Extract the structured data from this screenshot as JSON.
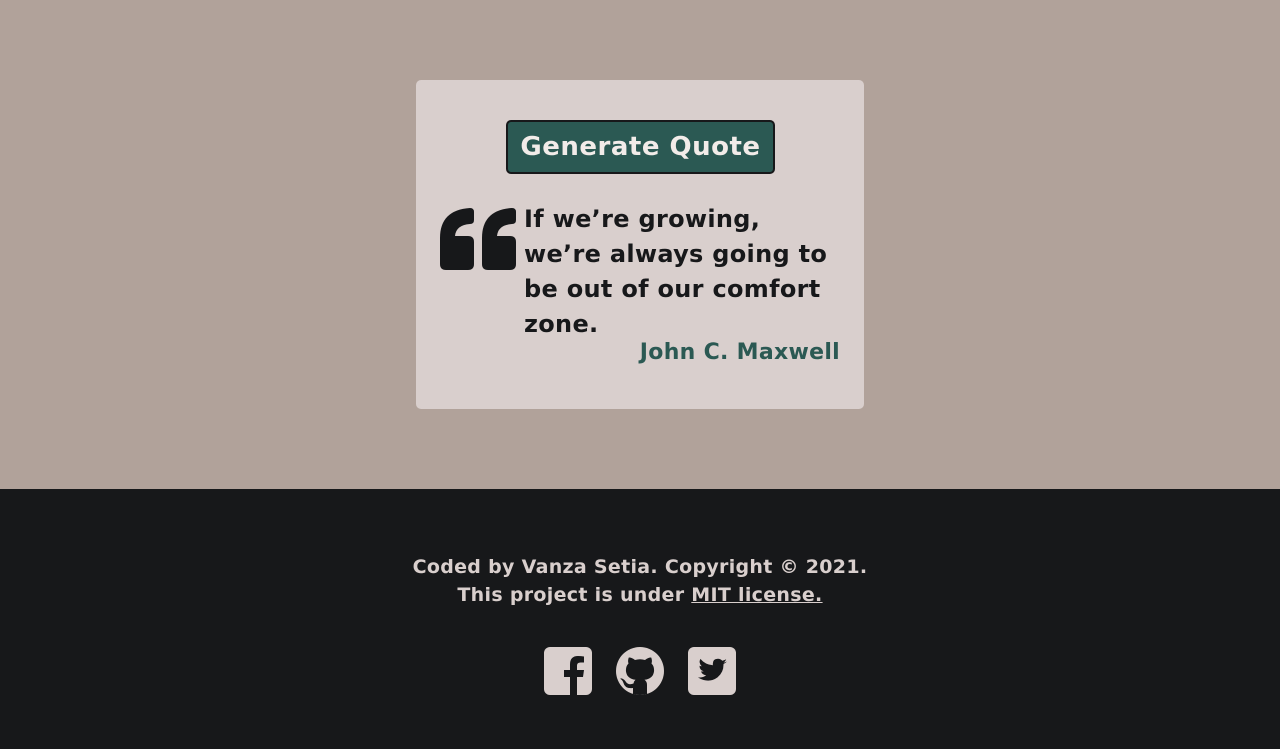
{
  "card": {
    "generate_label": "Generate Quote",
    "quote_icon": "quote-left-icon",
    "quote_text": "If we’re growing, we’re always going to be out of our comfort zone.",
    "author": "John C. Maxwell"
  },
  "footer": {
    "line1": "Coded by Vanza Setia. Copyright © 2021.",
    "line2_prefix": "This project is under ",
    "license_link": "MIT license.",
    "socials": [
      {
        "icon": "facebook-icon"
      },
      {
        "icon": "github-icon"
      },
      {
        "icon": "twitter-icon"
      }
    ]
  },
  "colors": {
    "page_bg": "#b1a29a",
    "card_bg": "#d9cfcd",
    "accent": "#2b5953",
    "dark": "#17181a",
    "light_text": "#f2ece9"
  }
}
